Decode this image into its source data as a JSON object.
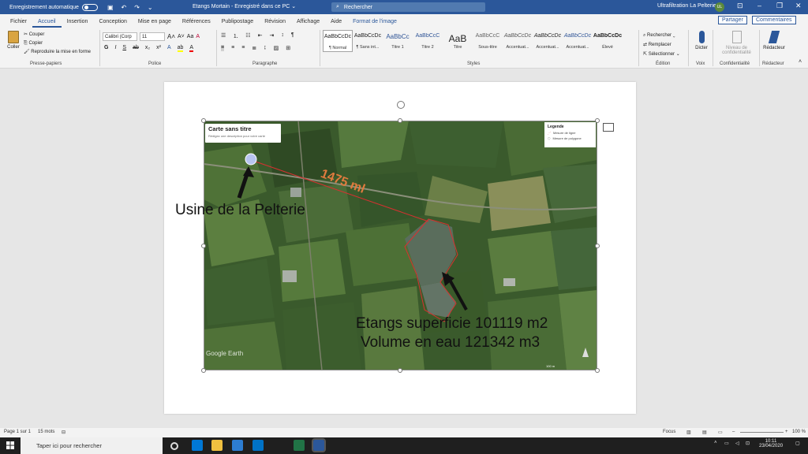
{
  "titlebar": {
    "autosave_label": "Enregistrement automatique",
    "doc_title": "Etangs Mortain  -  Enregistré dans ce PC ⌄",
    "search_placeholder": "Rechercher",
    "user_name": "Ultrafiltration La Pelterie",
    "user_initials": "UL",
    "accent_color": "#2b579a"
  },
  "tabs": [
    "Fichier",
    "Accueil",
    "Insertion",
    "Conception",
    "Mise en page",
    "Références",
    "Publipostage",
    "Révision",
    "Affichage",
    "Aide",
    "Format de l'image"
  ],
  "share_label": "Partager",
  "comments_label": "Commentaires",
  "ribbon": {
    "clipboard": {
      "paste": "Coller",
      "cut": "Couper",
      "copy": "Copier",
      "format_painter": "Reproduire la mise en forme",
      "label": "Presse-papiers"
    },
    "font": {
      "family": "Calibri (Corp",
      "size": "11",
      "label": "Police"
    },
    "paragraph": {
      "label": "Paragraphe"
    },
    "styles": {
      "label": "Styles",
      "items": [
        {
          "preview": "AaBbCcDc",
          "name": "¶ Normal"
        },
        {
          "preview": "AaBbCcDc",
          "name": "¶ Sans int..."
        },
        {
          "preview": "AaBbCc",
          "name": "Titre 1"
        },
        {
          "preview": "AaBbCcC",
          "name": "Titre 2"
        },
        {
          "preview": "AaB",
          "name": "Titre"
        },
        {
          "preview": "AaBbCcC",
          "name": "Sous-titre"
        },
        {
          "preview": "AaBbCcDc",
          "name": "Accentuat..."
        },
        {
          "preview": "AaBbCcDc",
          "name": "Accentuat..."
        },
        {
          "preview": "AaBbCcDc",
          "name": "Accentuat..."
        },
        {
          "preview": "AaBbCcDc",
          "name": "Élevé"
        }
      ]
    },
    "editing": {
      "find": "Rechercher",
      "replace": "Remplacer",
      "select": "Sélectionner",
      "label": "Édition"
    },
    "voice": {
      "dictate": "Dicter",
      "label": "Voix"
    },
    "sensitivity": {
      "button": "Niveau de confidentialité",
      "label": "Confidentialité"
    },
    "editor": {
      "button": "Rédacteur",
      "label": "Rédacteur"
    }
  },
  "image": {
    "map_title": "Carte sans titre",
    "map_desc": "Rédigez une description pour votre carte",
    "legend_title": "Legende",
    "legend_items": [
      "Mesure de ligne",
      "Mesure de polygone"
    ],
    "watermark": "Google Earth",
    "scale": "100 m",
    "label_usine": "Usine de la Pelterie",
    "label_distance": "1475 ml",
    "label_etangs_line1": "Etangs superficie 101119 m2",
    "label_etangs_line2": "Volume en eau 121342 m3"
  },
  "statusbar": {
    "page": "Page 1 sur 1",
    "words": "15 mots",
    "focus": "Focus",
    "zoom": "100 %"
  },
  "taskbar": {
    "search_placeholder": "Taper ici pour rechercher",
    "time": "10:11",
    "date": "23/04/2020"
  }
}
